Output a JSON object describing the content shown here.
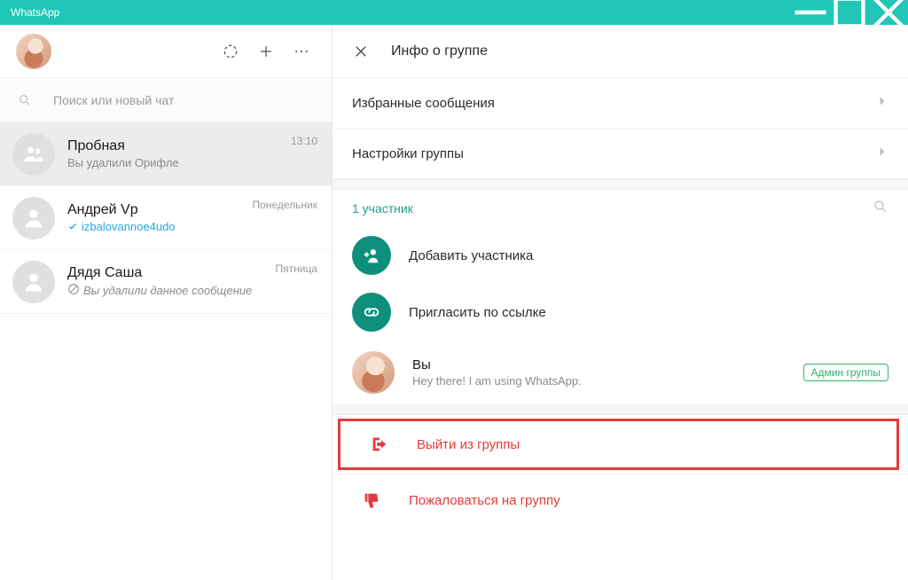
{
  "window": {
    "title": "WhatsApp"
  },
  "sidebar": {
    "search_placeholder": "Поиск или новый чат",
    "chats": [
      {
        "title": "Пробная",
        "subtitle": "Вы удалили Орифле",
        "time": "13:10",
        "active": true,
        "type": "group"
      },
      {
        "title": "Андрей Vp",
        "subtitle": "izbalovannoe4udo",
        "time": "Понедельник",
        "verified": true
      },
      {
        "title": "Дядя Саша",
        "subtitle": "Вы удалили данное сообщение",
        "time": "Пятница",
        "deleted": true
      }
    ]
  },
  "panel": {
    "title": "Инфо о группе",
    "starred": "Избранные сообщения",
    "settings": "Настройки группы",
    "participants_count": "1 участник",
    "add_participant": "Добавить участника",
    "invite_link": "Пригласить по ссылке",
    "member": {
      "name": "Вы",
      "status": "Hey there! I am using WhatsApp.",
      "badge": "Админ группы"
    },
    "leave": "Выйти из группы",
    "report": "Пожаловаться на группу"
  },
  "colors": {
    "accent": "#20c6b6",
    "teal": "#0d8f7b",
    "danger": "#e53a3a"
  }
}
